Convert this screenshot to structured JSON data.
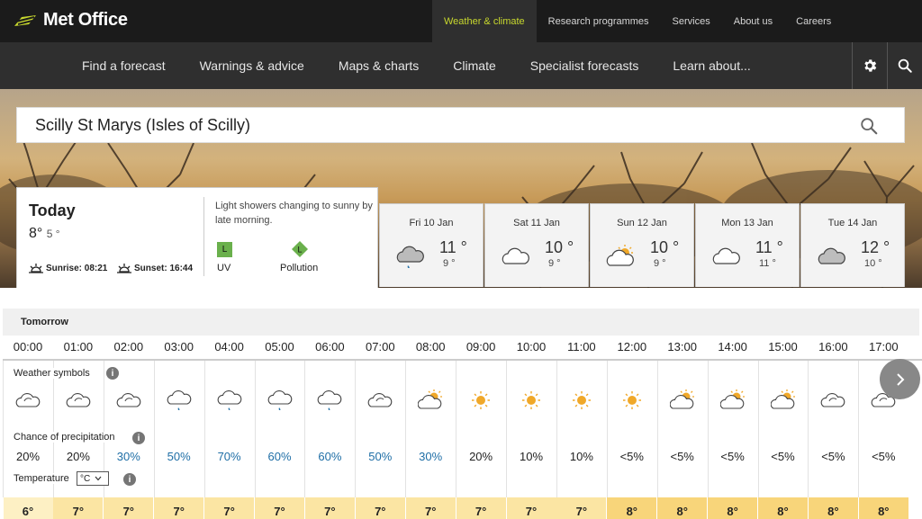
{
  "header": {
    "logo_text": "Met Office",
    "top_nav": [
      {
        "label": "Weather & climate",
        "active": true
      },
      {
        "label": "Research programmes"
      },
      {
        "label": "Services"
      },
      {
        "label": "About us"
      },
      {
        "label": "Careers"
      }
    ],
    "main_nav": [
      "Find a forecast",
      "Warnings & advice",
      "Maps & charts",
      "Climate",
      "Specialist forecasts",
      "Learn about..."
    ]
  },
  "search": {
    "location": "Scilly St Marys (Isles of Scilly)"
  },
  "today": {
    "title": "Today",
    "high": "8°",
    "low": "5 °",
    "sunrise": "Sunrise: 08:21",
    "sunset": "Sunset: 16:44",
    "description": "Light showers changing to sunny by late morning.",
    "uv_badge": "L",
    "uv_label": "UV",
    "pollution_badge": "L",
    "pollution_label": "Pollution"
  },
  "days": [
    {
      "label": "Fri 10 Jan",
      "high": "11 °",
      "low": "9 °",
      "icon": "rain-cloud-icon"
    },
    {
      "label": "Sat 11 Jan",
      "high": "10 °",
      "low": "9 °",
      "icon": "cloud-icon"
    },
    {
      "label": "Sun 12 Jan",
      "high": "10 °",
      "low": "9 °",
      "icon": "sun-cloud-icon"
    },
    {
      "label": "Mon 13 Jan",
      "high": "11 °",
      "low": "11 °",
      "icon": "cloud-icon"
    },
    {
      "label": "Tue 14 Jan",
      "high": "12 °",
      "low": "10 °",
      "icon": "grey-cloud-icon"
    }
  ],
  "forecast": {
    "day_label": "Tomorrow",
    "labels": {
      "symbols": "Weather symbols",
      "precip": "Chance of precipitation",
      "temperature": "Temperature",
      "unit": "°C"
    },
    "info_glyph": "i",
    "hours": [
      {
        "time": "00:00",
        "icon": "cloud",
        "precip": "20%",
        "temp": "6°"
      },
      {
        "time": "01:00",
        "icon": "cloud",
        "precip": "20%",
        "temp": "7°"
      },
      {
        "time": "02:00",
        "icon": "cloud",
        "precip": "30%",
        "temp": "7°"
      },
      {
        "time": "03:00",
        "icon": "rain",
        "precip": "50%",
        "temp": "7°"
      },
      {
        "time": "04:00",
        "icon": "rain",
        "precip": "70%",
        "temp": "7°"
      },
      {
        "time": "05:00",
        "icon": "rain",
        "precip": "60%",
        "temp": "7°"
      },
      {
        "time": "06:00",
        "icon": "rain",
        "precip": "60%",
        "temp": "7°"
      },
      {
        "time": "07:00",
        "icon": "cloud",
        "precip": "50%",
        "temp": "7°"
      },
      {
        "time": "08:00",
        "icon": "sun-cloud",
        "precip": "30%",
        "temp": "7°"
      },
      {
        "time": "09:00",
        "icon": "sun",
        "precip": "20%",
        "temp": "7°"
      },
      {
        "time": "10:00",
        "icon": "sun",
        "precip": "10%",
        "temp": "7°"
      },
      {
        "time": "11:00",
        "icon": "sun",
        "precip": "10%",
        "temp": "7°"
      },
      {
        "time": "12:00",
        "icon": "sun",
        "precip": "<5%",
        "temp": "8°"
      },
      {
        "time": "13:00",
        "icon": "sun-cloud",
        "precip": "<5%",
        "temp": "8°"
      },
      {
        "time": "14:00",
        "icon": "sun-cloud",
        "precip": "<5%",
        "temp": "8°"
      },
      {
        "time": "15:00",
        "icon": "sun-cloud",
        "precip": "<5%",
        "temp": "8°"
      },
      {
        "time": "16:00",
        "icon": "cloud",
        "precip": "<5%",
        "temp": "8°"
      },
      {
        "time": "17:00",
        "icon": "cloud",
        "precip": "<5%",
        "temp": "8°"
      }
    ]
  },
  "colors": {
    "accent": "#c8d82e",
    "precip_high": "#1e6ea6",
    "temp_7": "#fbe5a3",
    "temp_8": "#f8d57a",
    "uv_low": "#6ab04c"
  }
}
